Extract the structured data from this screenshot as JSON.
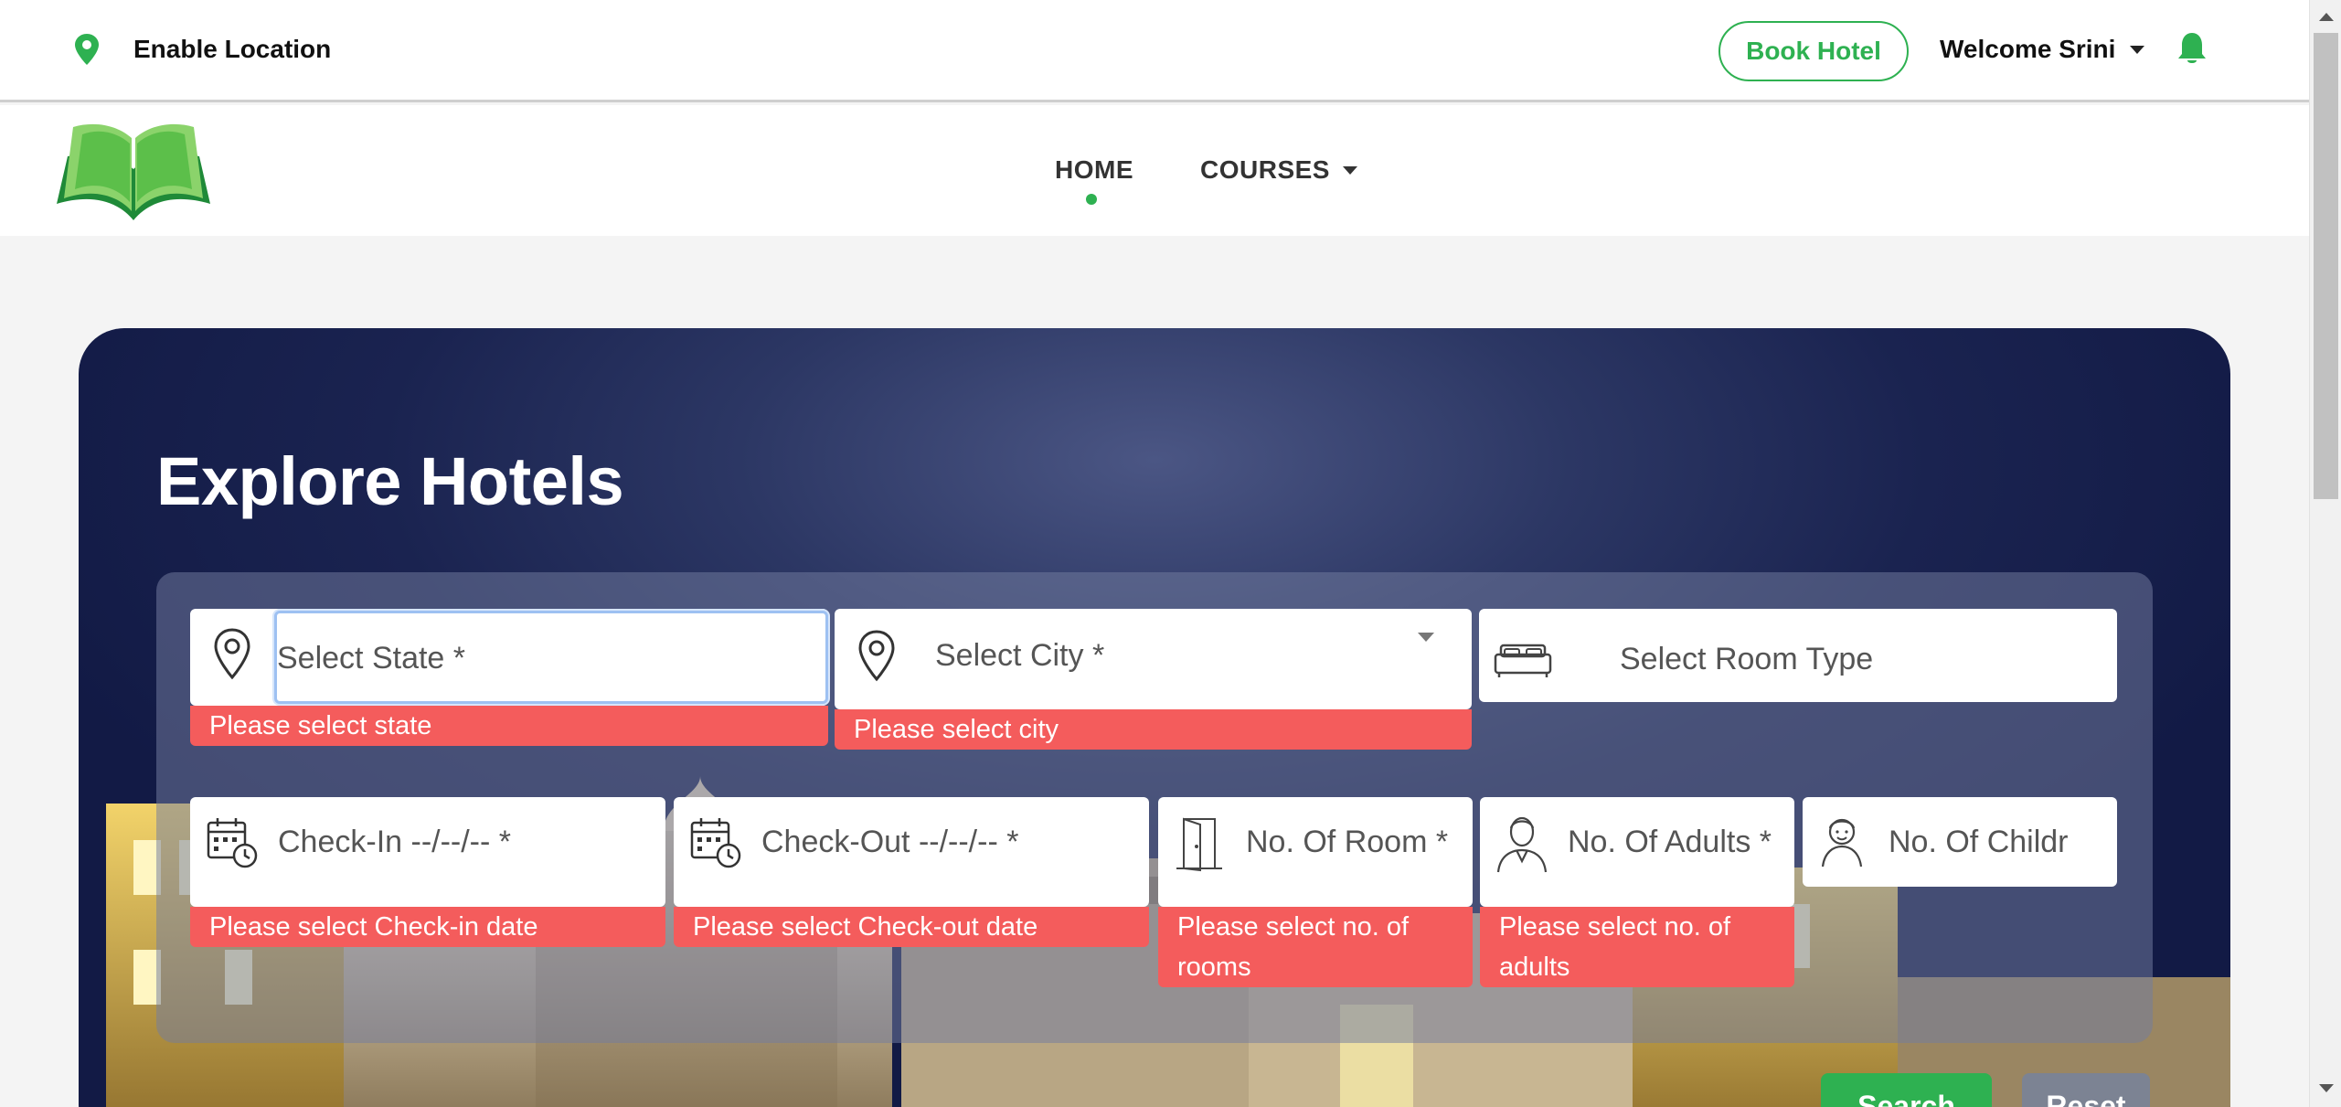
{
  "topbar": {
    "location_label": "Enable Location",
    "book_button": "Book Hotel",
    "welcome_label": "Welcome Srini"
  },
  "nav": {
    "home": "HOME",
    "courses": "COURSES"
  },
  "hero": {
    "title": "Explore Hotels"
  },
  "form": {
    "state": {
      "placeholder": "Select State *",
      "error": "Please select state"
    },
    "city": {
      "placeholder": "Select City *",
      "error": "Please select city"
    },
    "room_type": {
      "placeholder": "Select Room Type"
    },
    "checkin": {
      "placeholder": "Check-In --/--/-- *",
      "error": "Please select Check-in date"
    },
    "checkout": {
      "placeholder": "Check-Out --/--/-- *",
      "error": "Please select Check-out date"
    },
    "rooms": {
      "placeholder": "No. Of Room *",
      "error": "Please select no. of rooms"
    },
    "adults": {
      "placeholder": "No. Of Adults *",
      "error": "Please select no. of adults"
    },
    "children": {
      "placeholder": "No. Of Childr"
    }
  },
  "actions": {
    "search": "Search",
    "reset": "Reset"
  },
  "colors": {
    "brand_green": "#2eb151",
    "error_red": "#f45c5c",
    "hero_navy": "#1a2350"
  }
}
